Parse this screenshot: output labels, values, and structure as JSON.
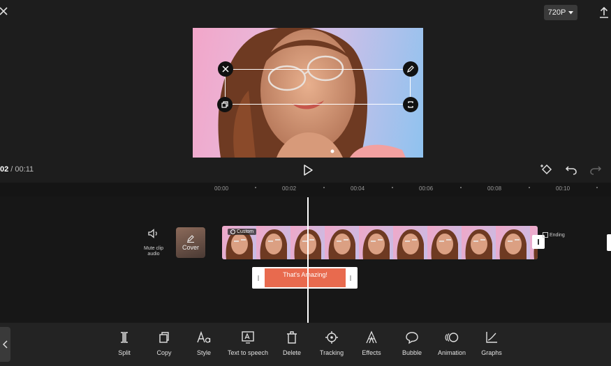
{
  "header": {
    "resolution_label": "720P",
    "icons": [
      "close-icon",
      "caret-down-icon",
      "export-icon"
    ]
  },
  "preview": {
    "overlay_icons": [
      "delete-icon",
      "edit-icon",
      "copy-icon",
      "rotate-scale-icon"
    ]
  },
  "playback": {
    "current_time": "02",
    "separator": " / ",
    "total_time": "00:11",
    "icons": [
      "play-icon",
      "keyframe-icon",
      "undo-icon",
      "redo-icon"
    ]
  },
  "ruler": {
    "labels": [
      "00:00",
      "00:02",
      "00:04",
      "00:06",
      "00:08",
      "00:10"
    ]
  },
  "track": {
    "mute_label": "Mute clip audio",
    "cover_label": "Cover",
    "custom_tag": "Custom",
    "ending_label": "Ending",
    "text_clip_label": "That's Amazing!"
  },
  "toolbar": {
    "items": [
      {
        "label": "Split",
        "icon": "split-icon"
      },
      {
        "label": "Copy",
        "icon": "copy-icon"
      },
      {
        "label": "Style",
        "icon": "style-icon"
      },
      {
        "label": "Text to speech",
        "icon": "text-to-speech-icon"
      },
      {
        "label": "Delete",
        "icon": "delete-icon"
      },
      {
        "label": "Tracking",
        "icon": "tracking-icon"
      },
      {
        "label": "Effects",
        "icon": "effects-icon"
      },
      {
        "label": "Bubble",
        "icon": "bubble-icon"
      },
      {
        "label": "Animation",
        "icon": "animation-icon"
      },
      {
        "label": "Graphs",
        "icon": "graphs-icon"
      }
    ]
  },
  "colors": {
    "background": "#171717",
    "text_clip": "#e86a4e",
    "preview_pink": "#f2a6c9",
    "preview_blue": "#8fc2ef"
  }
}
